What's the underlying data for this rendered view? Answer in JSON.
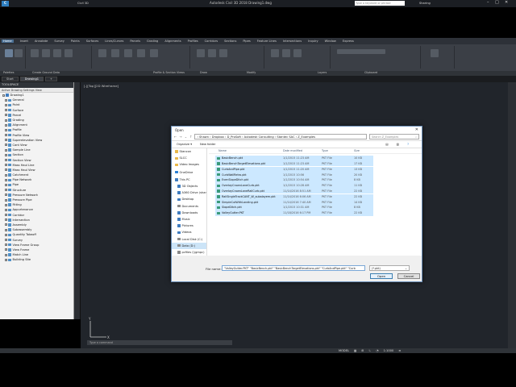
{
  "app": {
    "title": "Autodesk Civil 3D 2018    Drawing1.dwg",
    "search_placeholder": "Type a keyword or phrase",
    "user": "Sharing",
    "workspace": "Civil 3D"
  },
  "menubar": [
    "Home",
    "Insert",
    "Annotate",
    "Modify",
    "Analyze",
    "View",
    "Manage",
    "Output",
    "Survey",
    "Autodesk InfraWorks",
    "Collaborate",
    "Help",
    "Add-ins",
    "Featured Apps",
    "Express Tools"
  ],
  "toprow": [
    "Home",
    "Insert",
    "Annotate",
    "Survey",
    "Points",
    "Surfaces",
    "Lines/Curves",
    "Parcels",
    "Grading",
    "Alignments",
    "Profiles",
    "Corridors",
    "Sections",
    "Pipes",
    "Feature Lines",
    "Intersections",
    "Inquiry",
    "Window",
    "Express"
  ],
  "ribbon_groups": [
    "Palettes",
    "Create Ground Data",
    "Profile & Section Views",
    "Draw",
    "Modify",
    "Layers",
    "Clipboard"
  ],
  "file_tabs": [
    "Start",
    "Drawing1"
  ],
  "viewport_label": "[-][Top][2D Wireframe]",
  "toolspace": {
    "title": "TOOLSPACE",
    "subtitle": "Active Drawing Settings View",
    "root": "Drawing1",
    "items": [
      "General",
      "Point",
      "Surface",
      "Parcel",
      "Grading",
      "Alignment",
      "Profile",
      "Profile View",
      "Superelevation View",
      "Cant View",
      "Sample Line",
      "Section",
      "Section View",
      "Mass Haul Line",
      "Mass Haul View",
      "Catchment",
      "Pipe Network",
      "Pipe",
      "Structure",
      "Pressure Network",
      "Pressure Pipe",
      "Fitting",
      "Appurtenance",
      "Corridor",
      "Intersection",
      "Assembly",
      "Subassembly",
      "Quantity Takeoff",
      "Survey",
      "View Frame Group",
      "View Frame",
      "Match Line",
      "Building Site"
    ]
  },
  "command_line": "Type a command",
  "status": {
    "model": "MODEL",
    "scale": "1:1000"
  },
  "dialog": {
    "title": "Open",
    "close": "✕",
    "address": "›  Shawn  ›  Dropbox  ›  D_ProSoft  ›  Autodesk Consulting  ›  Stantec SAC  ›  Z_Examples",
    "search_placeholder": "Search Z_Examples",
    "organize": "Organize ▾",
    "new_folder": "New folder",
    "nav_items": [
      {
        "label": "Stancon",
        "color": "#e8b84a"
      },
      {
        "label": "SLCC",
        "color": "#e8b84a"
      },
      {
        "label": "Video Images",
        "color": "#e8b84a"
      },
      {
        "label": "OneDrive",
        "color": "#2a7fd4"
      },
      {
        "label": "This PC",
        "color": "#3f7cc0"
      },
      {
        "label": "3D Objects",
        "color": "#3f7cc0"
      },
      {
        "label": "A360 Drive (shar",
        "color": "#3f7cc0"
      },
      {
        "label": "Desktop",
        "color": "#3f7cc0"
      },
      {
        "label": "Documents",
        "color": "#8a8a8a"
      },
      {
        "label": "Downloads",
        "color": "#3f7cc0"
      },
      {
        "label": "Music",
        "color": "#3f7cc0"
      },
      {
        "label": "Pictures",
        "color": "#3f7cc0"
      },
      {
        "label": "Videos",
        "color": "#3f7cc0"
      },
      {
        "label": "Local Disk (C:)",
        "color": "#8a8a8a"
      },
      {
        "label": "Data (D:)",
        "color": "#8a8a8a"
      },
      {
        "label": "pcfiles (\\\\gmpc)",
        "color": "#8a8a8a"
      }
    ],
    "columns": [
      "Name",
      "Date modified",
      "Type",
      "Size"
    ],
    "files": [
      {
        "name": "BasicBench.pkt",
        "date": "1/1/2015 11:23 AM",
        "type": "PKT File",
        "size": "10 KB"
      },
      {
        "name": "BasicBenchTargetElevations.pkt",
        "date": "1/1/2015 11:23 AM",
        "type": "PKT File",
        "size": "17 KB"
      },
      {
        "name": "CurbAndPipe.pkt",
        "date": "1/1/2015 11:20 AM",
        "type": "PKT File",
        "size": "13 KB"
      },
      {
        "name": "CurbWallRetro.pkt",
        "date": "1/1/2015 10:56",
        "type": "PKT File",
        "size": "20 KB"
      },
      {
        "name": "EvenSlopeDitch.pkt",
        "date": "1/1/2015 10:54 AM",
        "type": "PKT File",
        "size": "8 KB"
      },
      {
        "name": "OverlayCrownLaneCurb.pkt",
        "date": "1/1/2015 10:28 AM",
        "type": "PKT File",
        "size": "11 KB"
      },
      {
        "name": "OverlayCrownLaneRailCurb.pkt",
        "date": "11/14/2016 8:51 AM",
        "type": "PKT File",
        "size": "22 KB"
      },
      {
        "name": "RailSingleTrackCANT_W_subalayem.pkt",
        "date": "11/14/2016 6:06 AM",
        "type": "PKT File",
        "size": "22 KB"
      },
      {
        "name": "SimpleCutWithLanding.pkt",
        "date": "11/14/2016 7:40 AM",
        "type": "PKT File",
        "size": "14 KB"
      },
      {
        "name": "SlopeDitch.pkt",
        "date": "1/1/2015 10:31 AM",
        "type": "PKT File",
        "size": "8 KB"
      },
      {
        "name": "ValleyGutter.PKT",
        "date": "11/18/2016 6:17 PM",
        "type": "PKT File",
        "size": "22 KB"
      }
    ],
    "filename_label": "File name:",
    "filename_value": "\"ValleyGutter.PKT\" \"BasicBench.pkt\" \"BasicBenchTargetElevations.pkt\" \"CurbAndPipe.pkt\" \"Curb",
    "filetype": "(*.pkt)",
    "open_button": "Open",
    "cancel_button": "Cancel"
  }
}
